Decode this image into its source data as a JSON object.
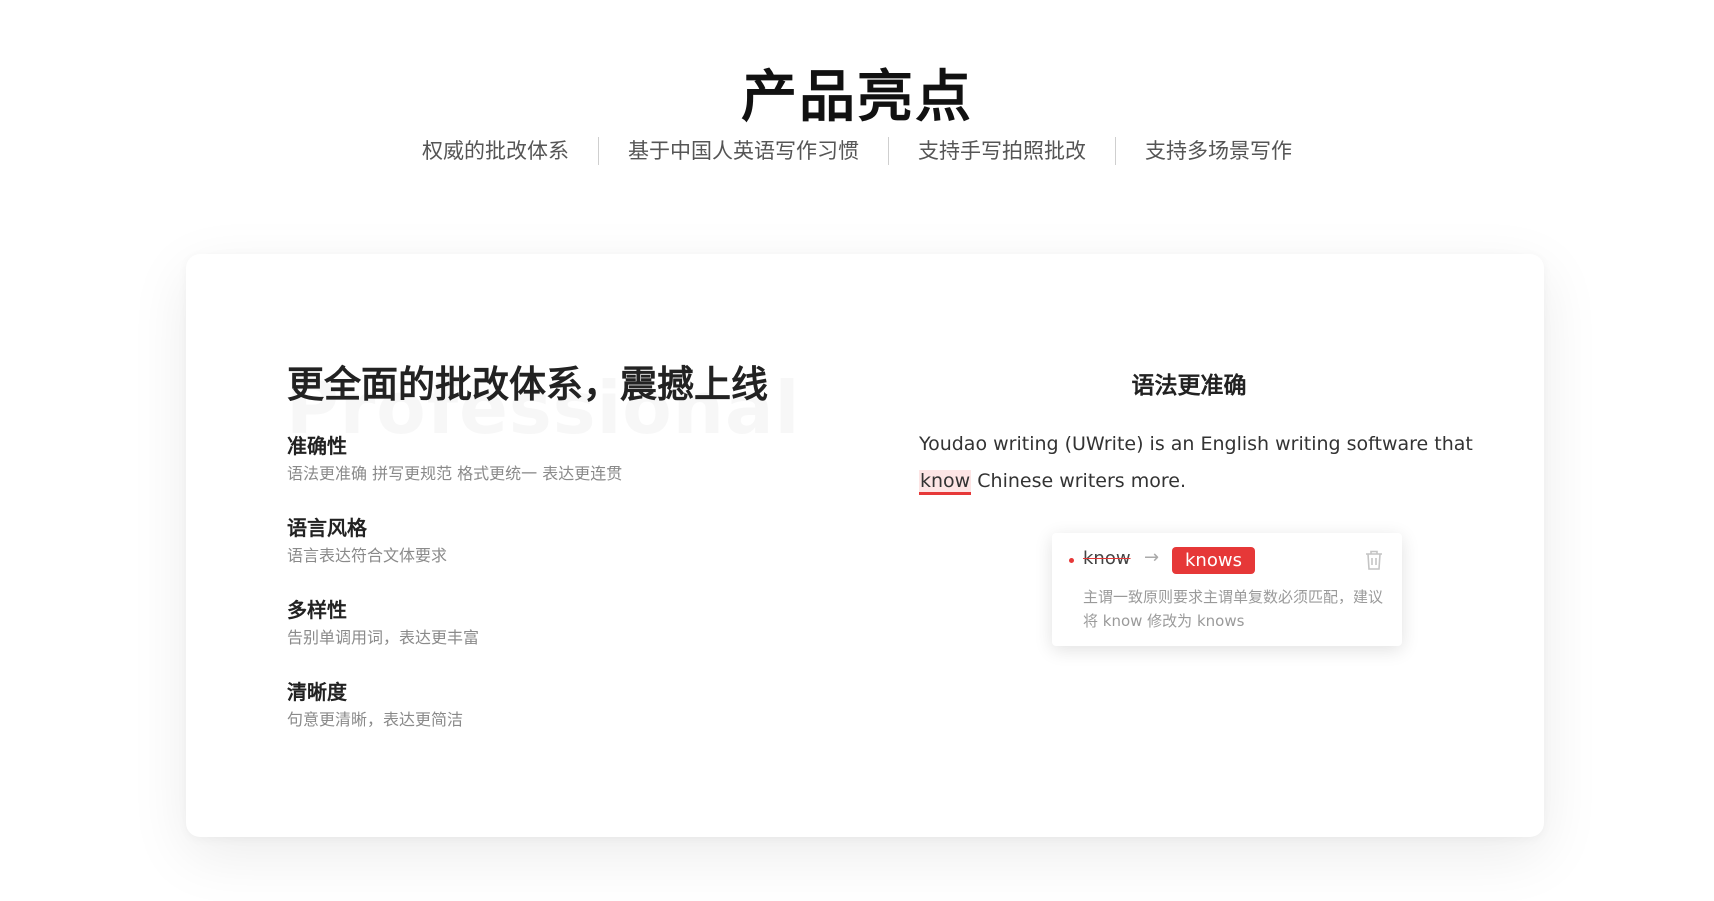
{
  "hero": {
    "title": "产品亮点",
    "tabs": [
      "权威的批改体系",
      "基于中国人英语写作习惯",
      "支持手写拍照批改",
      "支持多场景写作"
    ]
  },
  "card": {
    "watermark": "Professional",
    "heading": "更全面的批改体系，震撼上线",
    "features": [
      {
        "title": "准确性",
        "desc": "语法更准确 拼写更规范 格式更统一 表达更连贯"
      },
      {
        "title": "语言风格",
        "desc": "语言表达符合文体要求"
      },
      {
        "title": "多样性",
        "desc": "告别单调用词，表达更丰富"
      },
      {
        "title": "清晰度",
        "desc": "句意更清晰，表达更简洁"
      }
    ],
    "demo": {
      "title": "语法更准确",
      "text_before": "Youdao writing (UWrite) is an English writing software that ",
      "highlight": "know",
      "text_after": " Chinese writers more.",
      "correction": {
        "original": "know",
        "arrow": "→",
        "suggestion": "knows",
        "explanation": "主谓一致原则要求主谓单复数必须匹配，建议将 know 修改为 knows"
      }
    }
  },
  "colors": {
    "accent": "#e63838",
    "highlight_bg": "#fde5e5"
  },
  "icons": {
    "delete": "trash-icon",
    "arrow": "arrow-right-icon"
  }
}
